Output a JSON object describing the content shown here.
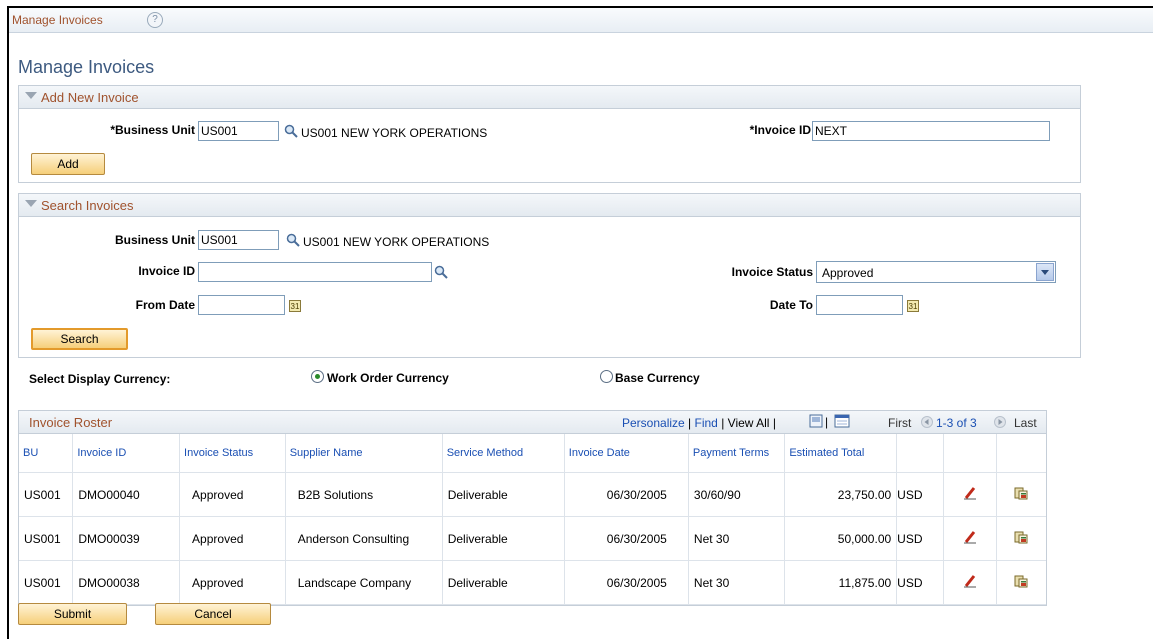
{
  "page": {
    "breadcrumb_title": "Manage Invoices",
    "help_glyph": "?",
    "title": "Manage Invoices"
  },
  "add_section": {
    "header": "Add New Invoice",
    "business_unit_label": "*Business Unit",
    "business_unit_value": "US001",
    "business_unit_desc": "US001 NEW YORK OPERATIONS",
    "invoice_id_label": "*Invoice ID",
    "invoice_id_value": "NEXT",
    "add_button": "Add"
  },
  "search_section": {
    "header": "Search Invoices",
    "business_unit_label": "Business Unit",
    "business_unit_value": "US001",
    "business_unit_desc": "US001 NEW YORK OPERATIONS",
    "invoice_id_label": "Invoice ID",
    "invoice_id_value": "",
    "invoice_status_label": "Invoice Status",
    "invoice_status_value": "Approved",
    "from_date_label": "From Date",
    "from_date_value": "",
    "date_to_label": "Date To",
    "date_to_value": "",
    "calendar_glyph": "31",
    "search_button": "Search"
  },
  "currency": {
    "label": "Select Display Currency:",
    "options": [
      {
        "label": "Work Order Currency",
        "selected": true
      },
      {
        "label": "Base Currency",
        "selected": false
      }
    ]
  },
  "roster": {
    "title": "Invoice Roster",
    "personalize": "Personalize",
    "sep": "|",
    "find": "Find",
    "view_all": "View All",
    "first": "First",
    "range": "1-3 of 3",
    "last": "Last",
    "columns": [
      "BU",
      "Invoice ID",
      "Invoice Status",
      "Supplier Name",
      "Service Method",
      "Invoice Date",
      "Payment Terms",
      "Estimated Total"
    ],
    "rows": [
      {
        "bu": "US001",
        "invoice_id": "DMO00040",
        "status": "Approved",
        "supplier": "B2B Solutions",
        "method": "Deliverable",
        "date": "06/30/2005",
        "terms": "30/60/90",
        "total": "23,750.00",
        "currency": "USD"
      },
      {
        "bu": "US001",
        "invoice_id": "DMO00039",
        "status": "Approved",
        "supplier": "Anderson Consulting",
        "method": "Deliverable",
        "date": "06/30/2005",
        "terms": "Net 30",
        "total": "50,000.00",
        "currency": "USD"
      },
      {
        "bu": "US001",
        "invoice_id": "DMO00038",
        "status": "Approved",
        "supplier": "Landscape Company",
        "method": "Deliverable",
        "date": "06/30/2005",
        "terms": "Net 30",
        "total": "11,875.00",
        "currency": "USD"
      }
    ]
  },
  "footer": {
    "submit": "Submit",
    "cancel": "Cancel"
  },
  "colors": {
    "section_label": "#a0522d",
    "link": "#1a4fb3",
    "title": "#3d5a80",
    "button_fill": "#f6cf7a"
  }
}
